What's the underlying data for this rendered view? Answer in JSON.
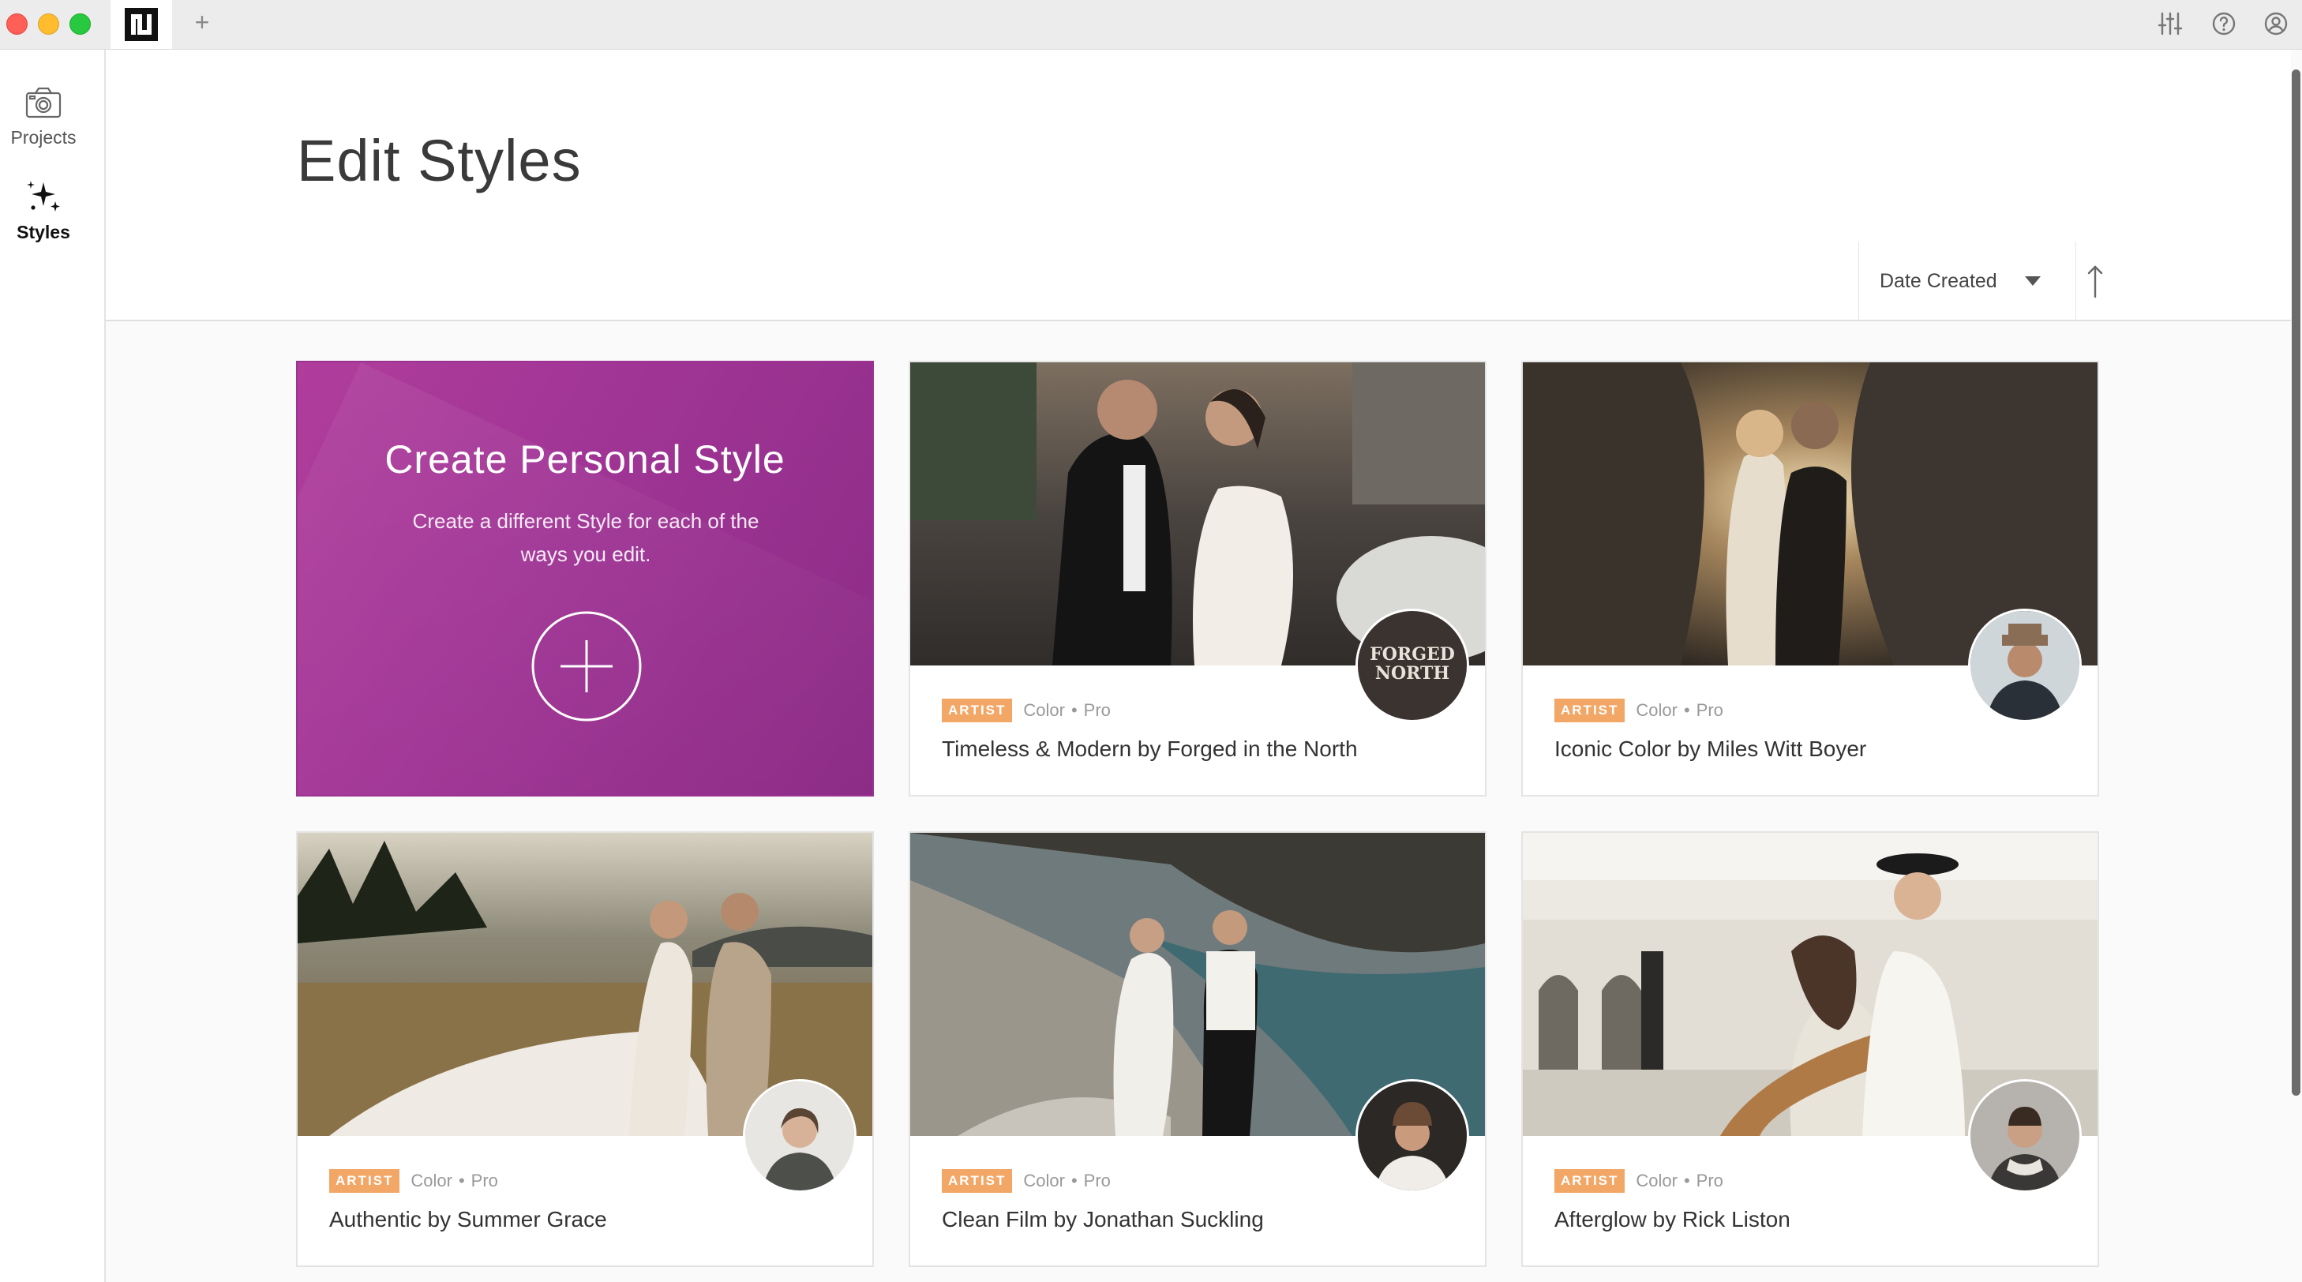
{
  "app": {
    "logo_icon": "app-logo-icon",
    "new_tab_label": "+"
  },
  "sidebar": {
    "items": [
      {
        "label": "Projects",
        "icon": "camera-icon",
        "active": false
      },
      {
        "label": "Styles",
        "icon": "sparkles-icon",
        "active": true
      }
    ]
  },
  "header": {
    "title": "Edit Styles"
  },
  "toolbar": {
    "sort_label": "Date Created",
    "sort_direction_icon": "arrow-up-icon"
  },
  "create_card": {
    "title": "Create Personal Style",
    "description": "Create a different Style for each of the ways you edit.",
    "action_icon": "plus-circle-icon"
  },
  "styles": [
    {
      "badge": "ARTIST",
      "category": "Color",
      "tier": "Pro",
      "title": "Timeless & Modern by Forged in the North",
      "avatar_text": "FORGED NORTH"
    },
    {
      "badge": "ARTIST",
      "category": "Color",
      "tier": "Pro",
      "title": "Iconic Color by Miles Witt Boyer"
    },
    {
      "badge": "ARTIST",
      "category": "Color",
      "tier": "Pro",
      "title": "Authentic by Summer Grace"
    },
    {
      "badge": "ARTIST",
      "category": "Color",
      "tier": "Pro",
      "title": "Clean Film by Jonathan Suckling"
    },
    {
      "badge": "ARTIST",
      "category": "Color",
      "tier": "Pro",
      "title": "Afterglow by Rick Liston"
    }
  ],
  "colors": {
    "create_card": "#a13596",
    "artist_badge": "#f2a766"
  }
}
